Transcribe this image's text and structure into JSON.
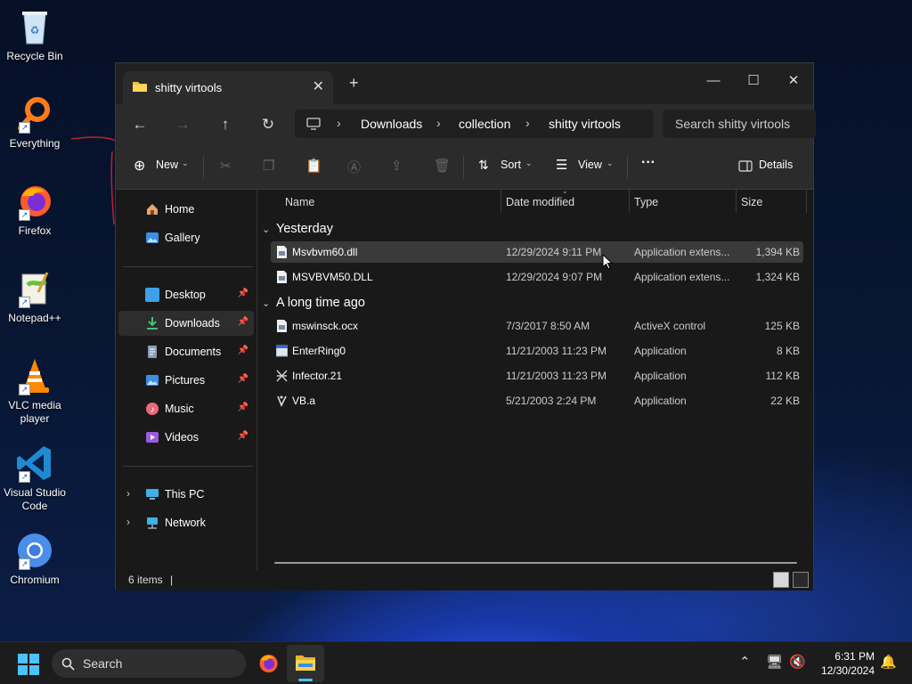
{
  "desktop": {
    "icons": [
      {
        "label": "Recycle Bin"
      },
      {
        "label": "Everything"
      },
      {
        "label": "Firefox"
      },
      {
        "label": "Notepad++"
      },
      {
        "label": "VLC media player"
      },
      {
        "label": "Visual Studio Code"
      },
      {
        "label": "Chromium"
      }
    ]
  },
  "window": {
    "tab_title": "shitty virtools",
    "tab_close": "✕",
    "new_tab": "+",
    "minimize": "—",
    "maximize": "☐",
    "close": "✕"
  },
  "nav": {
    "back": "←",
    "forward": "→",
    "up": "↑",
    "refresh": "↻",
    "breadcrumb": [
      "Downloads",
      "collection",
      "shitty virtools"
    ],
    "separator": "›",
    "search_placeholder": "Search shitty virtools"
  },
  "toolbar": {
    "new_label": "New",
    "sort_label": "Sort",
    "view_label": "View",
    "more_label": "···",
    "details_label": "Details"
  },
  "sidebar": {
    "quick": [
      {
        "label": "Home"
      },
      {
        "label": "Gallery"
      }
    ],
    "pinned": [
      {
        "label": "Desktop"
      },
      {
        "label": "Downloads"
      },
      {
        "label": "Documents"
      },
      {
        "label": "Pictures"
      },
      {
        "label": "Music"
      },
      {
        "label": "Videos"
      }
    ],
    "locations": [
      {
        "label": "This PC"
      },
      {
        "label": "Network"
      }
    ]
  },
  "columns": {
    "name": "Name",
    "date": "Date modified",
    "type": "Type",
    "size": "Size"
  },
  "groups": [
    {
      "label": "Yesterday",
      "files": [
        {
          "name": "Msvbvm60.dll",
          "date": "12/29/2024 9:11 PM",
          "type": "Application extens...",
          "size": "1,394 KB"
        },
        {
          "name": "MSVBVM50.DLL",
          "date": "12/29/2024 9:07 PM",
          "type": "Application extens...",
          "size": "1,324 KB"
        }
      ]
    },
    {
      "label": "A long time ago",
      "files": [
        {
          "name": "mswinsck.ocx",
          "date": "7/3/2017 8:50 AM",
          "type": "ActiveX control",
          "size": "125 KB"
        },
        {
          "name": "EnterRing0",
          "date": "11/21/2003 11:23 PM",
          "type": "Application",
          "size": "8 KB"
        },
        {
          "name": "Infector.21",
          "date": "11/21/2003 11:23 PM",
          "type": "Application",
          "size": "112 KB"
        },
        {
          "name": "VB.a",
          "date": "5/21/2003 2:24 PM",
          "type": "Application",
          "size": "22 KB"
        }
      ]
    }
  ],
  "status": {
    "item_count": "6 items",
    "divider": "|"
  },
  "taskbar": {
    "search_label": "Search",
    "time": "6:31 PM",
    "date": "12/30/2024"
  },
  "colors": {
    "accent": "#4cc2ff",
    "window_bg": "#191919",
    "toolbar_bg": "#2b2b2b",
    "selection": "#3a3a3a"
  }
}
